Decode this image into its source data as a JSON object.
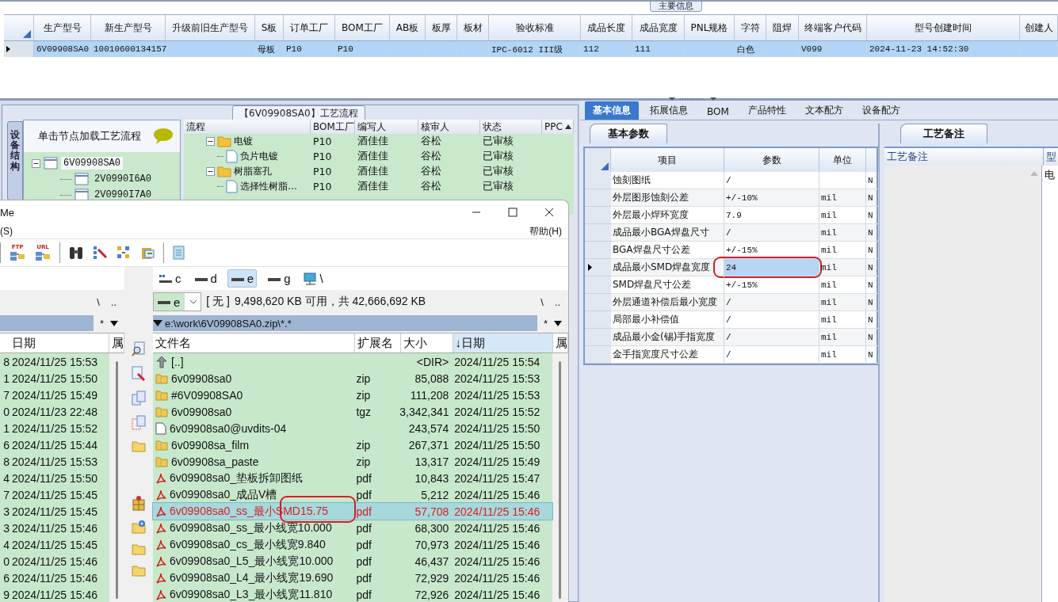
{
  "main_info": {
    "title": "主要信息",
    "columns": [
      "生产型号",
      "新生产型号",
      "升级前旧生产型号",
      "S板",
      "订单工厂",
      "BOM工厂",
      "AB板",
      "板厚",
      "板材",
      "验收标准",
      "成品长度",
      "成品宽度",
      "PNL规格",
      "字符",
      "阻焊",
      "终端客户代码",
      "型号创建时间",
      "创建人"
    ],
    "rows": [
      {
        "selected": true,
        "cells": [
          "6V09908SA0",
          "10010600134157",
          null,
          "母板",
          "P10",
          "P10",
          null,
          null,
          null,
          "IPC-6012 III级",
          "112",
          "111",
          null,
          "白色",
          null,
          "V099",
          "2024-11-23 14:52:30",
          null
        ]
      }
    ]
  },
  "process": {
    "title": "【6V09908SA0】工艺流程",
    "side_tab": "设备结构",
    "tree": {
      "hint": "单击节点加载工艺流程",
      "nodes": [
        {
          "label": "6V09908SA0",
          "expanded": true,
          "selected": true,
          "children": [
            {
              "label": "2V0990I6A0",
              "selected": false
            },
            {
              "label": "2V0990I7A0",
              "selected": false
            }
          ]
        }
      ]
    },
    "grid": {
      "columns": [
        "流程",
        "BOM工厂",
        "编写人",
        "核审人",
        "状态",
        "PPC"
      ],
      "rows": [
        {
          "kind": "folder",
          "name": "电镀",
          "bom": "P10",
          "writer": "酒佳佳",
          "reviewer": "谷松",
          "status": "已审核",
          "expanded": true,
          "children": [
            {
              "kind": "file",
              "name": "负片电镀",
              "bom": "P10",
              "writer": "酒佳佳",
              "reviewer": "谷松",
              "status": "已审核"
            }
          ]
        },
        {
          "kind": "folder",
          "name": "树脂塞孔",
          "bom": "P10",
          "writer": "酒佳佳",
          "reviewer": "谷松",
          "status": "已审核",
          "expanded": true,
          "children": [
            {
              "kind": "file",
              "name": "选择性树脂…",
              "bom": "P10",
              "writer": "酒佳佳",
              "reviewer": "谷松",
              "status": "已审核"
            }
          ]
        }
      ]
    }
  },
  "right_panel": {
    "tabs": [
      {
        "label": "基本信息",
        "selected": true
      },
      {
        "label": "拓展信息",
        "selected": false
      },
      {
        "label": "BOM",
        "selected": false
      },
      {
        "label": "产品特性",
        "selected": false
      },
      {
        "label": "文本配方",
        "selected": false
      },
      {
        "label": "设备配方",
        "selected": false
      }
    ],
    "subtab": "基本参数",
    "columns": [
      "项目",
      "参数",
      "单位"
    ],
    "rows": [
      {
        "item": "蚀刻图纸",
        "value": "/",
        "unit": null,
        "flag": "N",
        "selected": false,
        "circled": false
      },
      {
        "item": "外层图形蚀刻公差",
        "value": "+/-10%",
        "unit": "mil",
        "flag": "N",
        "selected": false,
        "circled": false
      },
      {
        "item": "外层最小焊环宽度",
        "value": "7.9",
        "unit": "mil",
        "flag": "N",
        "selected": false,
        "circled": false
      },
      {
        "item": "成品最小BGA焊盘尺寸",
        "value": "/",
        "unit": "mil",
        "flag": "N",
        "selected": false,
        "circled": false
      },
      {
        "item": "BGA焊盘尺寸公差",
        "value": "+/-15%",
        "unit": "mil",
        "flag": "N",
        "selected": false,
        "circled": false
      },
      {
        "item": "成品最小SMD焊盘宽度",
        "value": "24",
        "unit": "mil",
        "flag": "N",
        "selected": true,
        "circled": true
      },
      {
        "item": "SMD焊盘尺寸公差",
        "value": "+/-15%",
        "unit": "mil",
        "flag": "N",
        "selected": false,
        "circled": false
      },
      {
        "item": "外层通道补偿后最小宽度",
        "value": "/",
        "unit": "mil",
        "flag": "N",
        "selected": false,
        "circled": false
      },
      {
        "item": "局部最小补偿值",
        "value": "/",
        "unit": "mil",
        "flag": "N",
        "selected": false,
        "circled": false
      },
      {
        "item": "成品最小金(锡)手指宽度",
        "value": "/",
        "unit": "mil",
        "flag": "N",
        "selected": false,
        "circled": false
      },
      {
        "item": "金手指宽度尺寸公差",
        "value": "/",
        "unit": "mil",
        "flag": "N",
        "selected": false,
        "circled": false
      }
    ],
    "notes": {
      "tab": "工艺备注",
      "columns": [
        "工艺备注",
        "型"
      ],
      "cells": [
        "电"
      ]
    }
  },
  "file_manager": {
    "title": "Me",
    "menu": [
      "(S)",
      "帮助(H)"
    ],
    "toolbar": [
      {
        "kind": "ftp",
        "label": "FTP"
      },
      {
        "kind": "url",
        "label": "URL"
      },
      {
        "kind": "separator"
      },
      {
        "kind": "binoculars"
      },
      {
        "kind": "rename"
      },
      {
        "kind": "sync"
      },
      {
        "kind": "pack"
      },
      {
        "kind": "separator"
      },
      {
        "kind": "notepad"
      }
    ],
    "drives": [
      {
        "letter": "c",
        "kind": "system",
        "selected": false
      },
      {
        "letter": "d",
        "kind": "disk",
        "selected": false
      },
      {
        "letter": "e",
        "kind": "disk",
        "selected": true
      },
      {
        "letter": "g",
        "kind": "disk",
        "selected": false
      },
      {
        "letter": "\\",
        "kind": "network",
        "selected": false
      }
    ],
    "buttons": [
      {
        "kind": "view"
      },
      {
        "kind": "edit"
      },
      {
        "kind": "copy"
      },
      {
        "kind": "move"
      },
      {
        "kind": "folder"
      },
      {
        "kind": "spacer"
      },
      {
        "kind": "package"
      },
      {
        "kind": "new-folder"
      },
      {
        "kind": "folder"
      },
      {
        "kind": "folder"
      }
    ],
    "left_panel": {
      "nav": [
        "\\",
        ".."
      ],
      "filter": "*",
      "columns": [
        "日期",
        "属"
      ],
      "rows": [
        {
          "column_1": "8",
          "date": "2024/11/25 15:53"
        },
        {
          "column_1": "1",
          "date": "2024/11/25 15:50"
        },
        {
          "column_1": "7",
          "date": "2024/11/25 15:49"
        },
        {
          "column_1": "0",
          "date": "2024/11/23 22:48"
        },
        {
          "column_1": "1",
          "date": "2024/11/25 15:52"
        },
        {
          "column_1": "6",
          "date": "2024/11/25 15:44"
        },
        {
          "column_1": "8",
          "date": "2024/11/25 15:53"
        },
        {
          "column_1": "4",
          "date": "2024/11/25 15:50"
        },
        {
          "column_1": "7",
          "date": "2024/11/25 15:45"
        },
        {
          "column_1": "3",
          "date": "2024/11/25 15:45"
        },
        {
          "column_1": "3",
          "date": "2024/11/25 15:46"
        },
        {
          "column_1": "4",
          "date": "2024/11/25 15:45"
        },
        {
          "column_1": "0",
          "date": "2024/11/25 15:46"
        },
        {
          "column_1": "6",
          "date": "2024/11/25 15:46"
        },
        {
          "column_1": "9",
          "date": "2024/11/25 15:46"
        }
      ]
    },
    "right_panel": {
      "drive": "e",
      "volume": "[ 无 ]",
      "free_info": "9,498,620 KB 可用，共 42,666,692 KB",
      "nav": [
        "\\",
        ".."
      ],
      "path": "e:\\work\\6V09908SA0.zip\\*.*",
      "filter": "*",
      "columns": [
        {
          "label": "文件名",
          "sorted": false
        },
        {
          "label": "扩展名",
          "sorted": false
        },
        {
          "label": "大小",
          "sorted": false
        },
        {
          "label": "↓日期",
          "sorted": true
        },
        {
          "label": "属",
          "sorted": false
        }
      ],
      "rows": [
        {
          "kind": "up",
          "name": "[..]",
          "ext": null,
          "size": "<DIR>",
          "date": "2024/11/25 15:54",
          "selected": false,
          "circled": false
        },
        {
          "kind": "archive",
          "name": "6v09908sa0",
          "ext": "zip",
          "size": "85,088",
          "date": "2024/11/25 15:53",
          "selected": false,
          "circled": false
        },
        {
          "kind": "archive",
          "name": "#6V09908SA0",
          "ext": "zip",
          "size": "111,208",
          "date": "2024/11/25 15:53",
          "selected": false,
          "circled": false
        },
        {
          "kind": "archive",
          "name": "6v09908sa0",
          "ext": "tgz",
          "size": "3,342,341",
          "date": "2024/11/25 15:52",
          "selected": false,
          "circled": false
        },
        {
          "kind": "file",
          "name": "6v09908sa0@uvdits-04",
          "ext": null,
          "size": "243,574",
          "date": "2024/11/25 15:50",
          "selected": false,
          "circled": false
        },
        {
          "kind": "archive",
          "name": "6v09908sa_film",
          "ext": "zip",
          "size": "267,371",
          "date": "2024/11/25 15:50",
          "selected": false,
          "circled": false
        },
        {
          "kind": "archive",
          "name": "6v09908sa_paste",
          "ext": "zip",
          "size": "13,317",
          "date": "2024/11/25 15:49",
          "selected": false,
          "circled": false
        },
        {
          "kind": "pdf",
          "name": "6v09908sa0_垫板拆卸图纸",
          "ext": "pdf",
          "size": "10,843",
          "date": "2024/11/25 15:47",
          "selected": false,
          "circled": false
        },
        {
          "kind": "pdf",
          "name": "6v09908sa0_成品V槽",
          "ext": "pdf",
          "size": "5,212",
          "date": "2024/11/25 15:46",
          "selected": false,
          "circled": false
        },
        {
          "kind": "pdf",
          "name": "6v09908sa0_ss_最小SMD15.75",
          "ext": "pdf",
          "size": "57,708",
          "date": "2024/11/25 15:46",
          "selected": true,
          "circled": true
        },
        {
          "kind": "pdf",
          "name": "6v09908sa0_ss_最小线宽10.000",
          "ext": "pdf",
          "size": "68,300",
          "date": "2024/11/25 15:46",
          "selected": false,
          "circled": false
        },
        {
          "kind": "pdf",
          "name": "6v09908sa0_cs_最小线宽9.840",
          "ext": "pdf",
          "size": "70,973",
          "date": "2024/11/25 15:46",
          "selected": false,
          "circled": false
        },
        {
          "kind": "pdf",
          "name": "6v09908sa0_L5_最小线宽10.000",
          "ext": "pdf",
          "size": "46,437",
          "date": "2024/11/25 15:46",
          "selected": false,
          "circled": false
        },
        {
          "kind": "pdf",
          "name": "6v09908sa0_L4_最小线宽19.690",
          "ext": "pdf",
          "size": "72,929",
          "date": "2024/11/25 15:46",
          "selected": false,
          "circled": false
        },
        {
          "kind": "pdf",
          "name": "6v09908sa0_L3_最小线宽11.810",
          "ext": "pdf",
          "size": "72,926",
          "date": "2024/11/25 15:46",
          "selected": false,
          "circled": false
        }
      ]
    }
  }
}
